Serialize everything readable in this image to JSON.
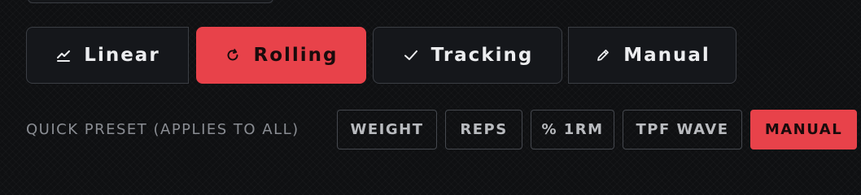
{
  "modes": {
    "linear_label": "Linear",
    "rolling_label": "Rolling",
    "tracking_label": "Tracking",
    "manual_label": "Manual",
    "selected": "Rolling",
    "icons": {
      "linear": "line-chart-icon",
      "rolling": "refresh-icon",
      "tracking": "check-icon",
      "manual": "pencil-icon"
    }
  },
  "presets": {
    "label": "QUICK PRESET (APPLIES TO ALL)",
    "options": [
      "WEIGHT",
      "REPS",
      "% 1RM",
      "TPF WAVE",
      "MANUAL"
    ],
    "selected": "MANUAL"
  },
  "colors": {
    "accent": "#e8424a",
    "background": "#0f1012",
    "button_bg": "#15171b",
    "border": "#3b3e44"
  }
}
